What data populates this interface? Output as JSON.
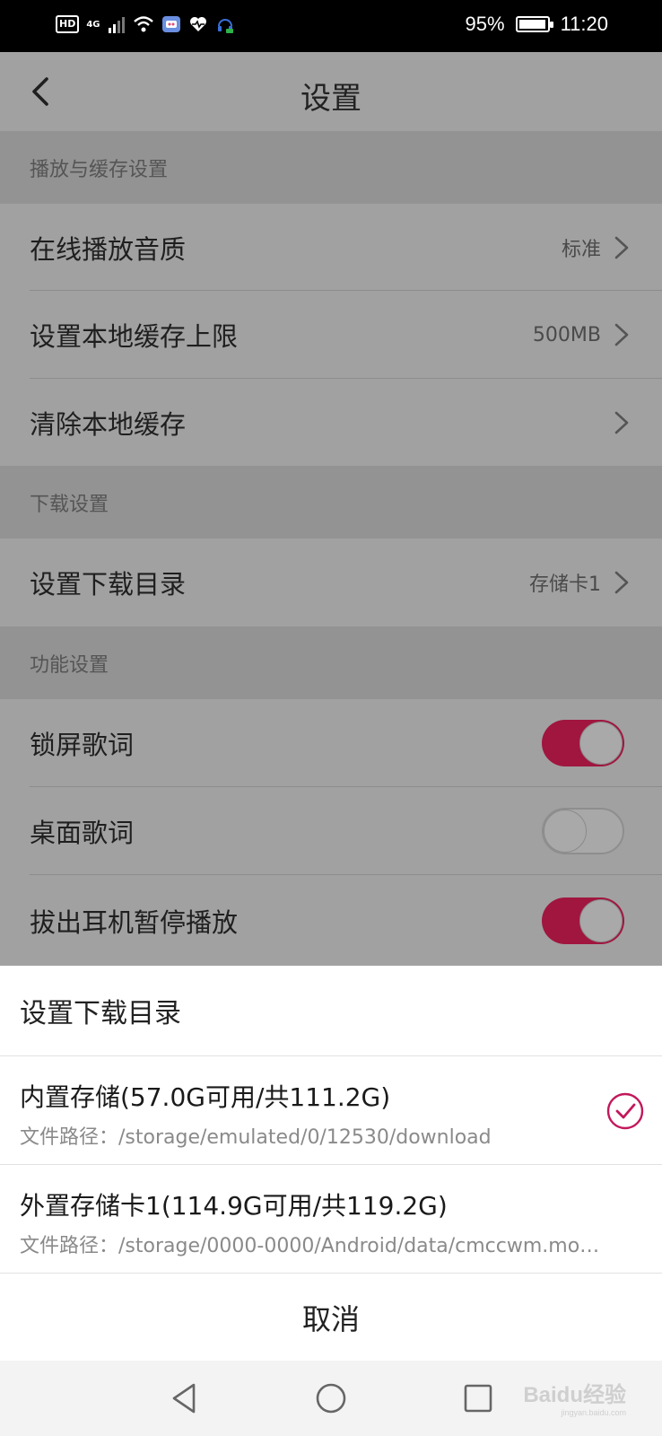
{
  "status_bar": {
    "hd": "HD",
    "network": "4G",
    "battery_percent": "95%",
    "time": "11:20",
    "icons": [
      "hd-icon",
      "signal-icon",
      "wifi-icon",
      "app-notification-icon",
      "health-icon",
      "headset-icon"
    ]
  },
  "header": {
    "title": "设置",
    "back_icon": "chevron-left-icon"
  },
  "sections": {
    "playback": {
      "title": "播放与缓存设置",
      "items": [
        {
          "label": "在线播放音质",
          "value": "标准"
        },
        {
          "label": "设置本地缓存上限",
          "value": "500MB"
        },
        {
          "label": "清除本地缓存",
          "value": ""
        }
      ]
    },
    "download": {
      "title": "下载设置",
      "items": [
        {
          "label": "设置下载目录",
          "value": "存储卡1"
        }
      ]
    },
    "features": {
      "title": "功能设置",
      "items": [
        {
          "label": "锁屏歌词",
          "toggle": true
        },
        {
          "label": "桌面歌词",
          "toggle": false
        },
        {
          "label": "拔出耳机暂停播放",
          "toggle": true
        }
      ]
    }
  },
  "sheet": {
    "title": "设置下载目录",
    "options": [
      {
        "title": "内置存储(57.0G可用/共111.2G)",
        "path": "文件路径：/storage/emulated/0/12530/download",
        "selected": true
      },
      {
        "title": "外置存储卡1(114.9G可用/共119.2G)",
        "path": "文件路径：/storage/0000-0000/Android/data/cmccwm.mo…",
        "selected": false
      }
    ],
    "cancel": "取消"
  },
  "nav": {
    "back": "nav-back-icon",
    "home": "nav-home-icon",
    "recents": "nav-recents-icon"
  },
  "watermark": {
    "text": "Baidu经验",
    "sub": "jingyan.baidu.com"
  },
  "colors": {
    "accent": "#c2185b",
    "toggle_on": "#a0163f"
  }
}
